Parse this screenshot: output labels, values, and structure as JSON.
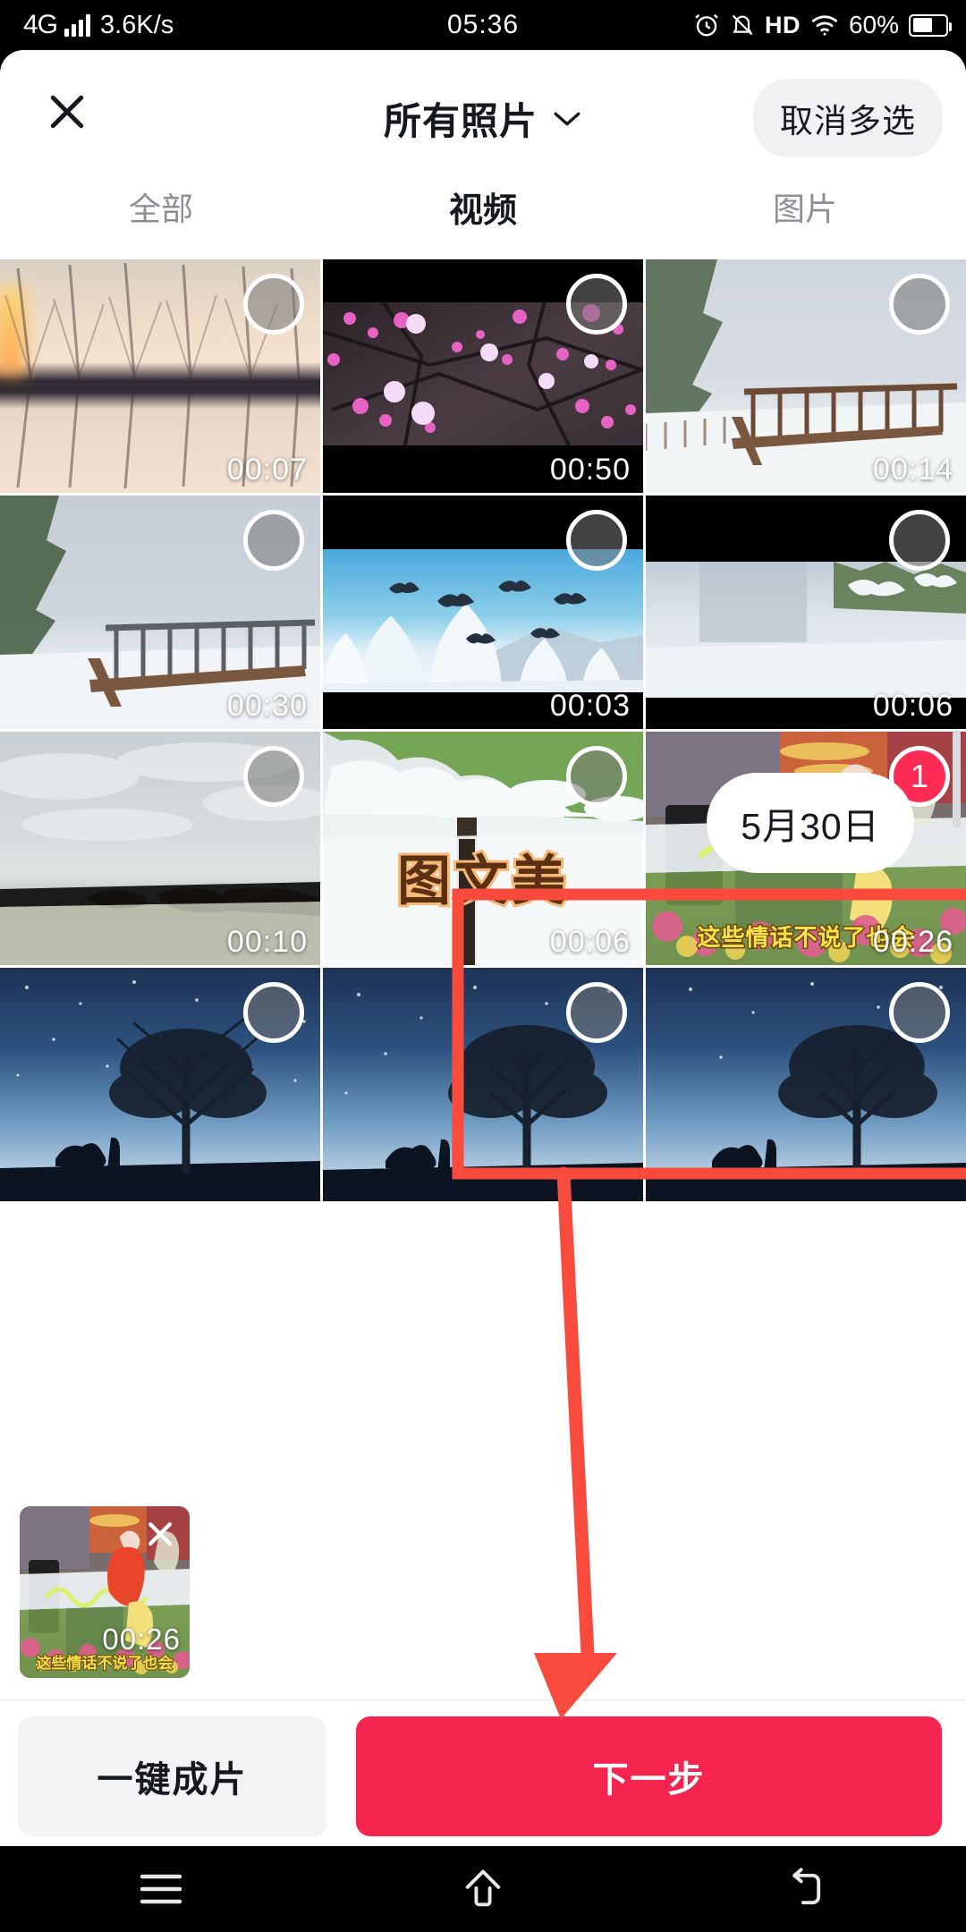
{
  "statusbar": {
    "network": "4G",
    "speed": "3.6K/s",
    "time": "05:36",
    "hd": "HD",
    "battery_pct": "60%",
    "icons": [
      "signal-bars-icon",
      "alarm-clock-icon",
      "mute-bell-icon",
      "hd-icon",
      "wifi-icon",
      "battery-icon"
    ]
  },
  "header": {
    "close_label": "close-icon",
    "title": "所有照片",
    "chevron": "chevron-down-icon",
    "multiselect_label": "取消多选"
  },
  "tabs": [
    {
      "label": "全部",
      "active": false
    },
    {
      "label": "视频",
      "active": true
    },
    {
      "label": "图片",
      "active": false
    }
  ],
  "date_pill": "5月30日",
  "grid": {
    "columns": 3,
    "items": [
      {
        "duration": "00:07",
        "selected": false,
        "badge": "",
        "caption": "",
        "subtitle": "",
        "scene": "sunset-trees-water"
      },
      {
        "duration": "00:50",
        "selected": false,
        "badge": "",
        "caption": "",
        "subtitle": "",
        "scene": "plum-blossom-night"
      },
      {
        "duration": "00:14",
        "selected": false,
        "badge": "",
        "caption": "",
        "subtitle": "",
        "scene": "snow-boardwalk"
      },
      {
        "duration": "00:30",
        "selected": false,
        "badge": "",
        "caption": "",
        "subtitle": "",
        "scene": "snow-boardwalk-2"
      },
      {
        "duration": "00:03",
        "selected": false,
        "badge": "",
        "caption": "",
        "subtitle": "",
        "scene": "cranes-over-snow-forest"
      },
      {
        "duration": "00:06",
        "selected": false,
        "badge": "",
        "caption": "",
        "subtitle": "",
        "scene": "snow-tree-pale"
      },
      {
        "duration": "00:10",
        "selected": false,
        "badge": "",
        "caption": "",
        "subtitle": "",
        "scene": "lake-overcast"
      },
      {
        "duration": "00:06",
        "selected": false,
        "badge": "",
        "caption": "图文美",
        "subtitle": "",
        "scene": "snow-branch-text"
      },
      {
        "duration": "00:26",
        "selected": true,
        "badge": "1",
        "caption": "",
        "subtitle": "这些情话不说了也会",
        "scene": "stage-singer-flowers"
      },
      {
        "duration": "",
        "selected": false,
        "badge": "",
        "caption": "",
        "subtitle": "",
        "scene": "starry-tree-horse"
      },
      {
        "duration": "",
        "selected": false,
        "badge": "",
        "caption": "",
        "subtitle": "",
        "scene": "starry-tree-horse"
      },
      {
        "duration": "",
        "selected": false,
        "badge": "",
        "caption": "",
        "subtitle": "",
        "scene": "starry-tree-horse"
      }
    ]
  },
  "tray": {
    "item": {
      "duration": "00:26",
      "subtitle": "这些情话不说了也会",
      "remove_label": "remove-icon"
    }
  },
  "bottom": {
    "auto_label": "一键成片",
    "next_label": "下一步"
  },
  "navbar": {
    "menu": "menu-icon",
    "home": "home-icon",
    "back": "back-icon"
  },
  "colors": {
    "accent_red": "#fe2c55",
    "next_button": "#f5254f",
    "annotation": "#f94b3d",
    "text_primary": "#15181f",
    "text_muted": "#8c8f98",
    "chip_bg": "#f1f1f3"
  }
}
